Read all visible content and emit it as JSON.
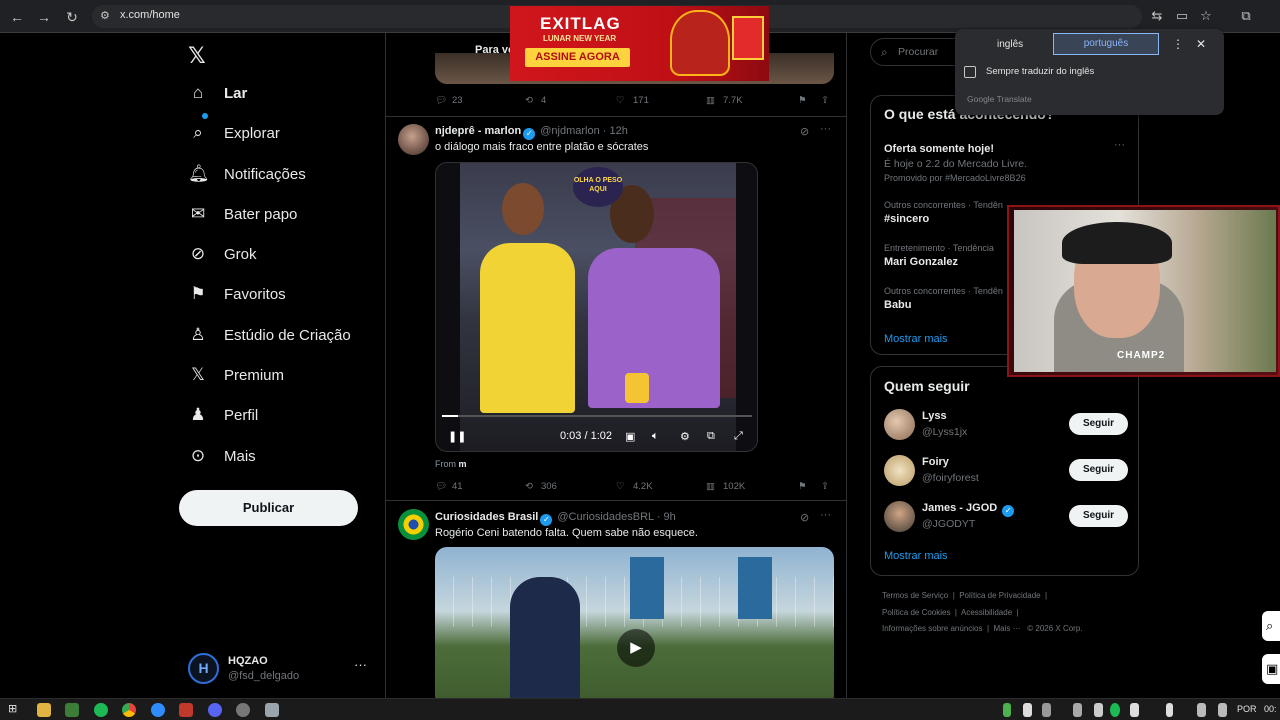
{
  "browser": {
    "url": "x.com/home"
  },
  "sidebar": {
    "items": [
      {
        "label": "Lar",
        "icon": "home-icon"
      },
      {
        "label": "Explorar",
        "icon": "search-icon"
      },
      {
        "label": "Notificações",
        "icon": "bell-icon"
      },
      {
        "label": "Bater papo",
        "icon": "mail-icon"
      },
      {
        "label": "Grok",
        "icon": "grok-icon"
      },
      {
        "label": "Favoritos",
        "icon": "bookmark-icon"
      },
      {
        "label": "Estúdio de Criação",
        "icon": "studio-icon"
      },
      {
        "label": "Premium",
        "icon": "x-icon"
      },
      {
        "label": "Perfil",
        "icon": "user-icon"
      },
      {
        "label": "Mais",
        "icon": "more-icon"
      }
    ],
    "post_label": "Publicar",
    "account": {
      "name": "HQZAO",
      "handle": "@fsd_delgado",
      "avatar_letter": "H"
    }
  },
  "feed": {
    "tab_label": "Para vo",
    "prev_actions": {
      "replies": "23",
      "reposts": "4",
      "likes": "171",
      "views": "7.7K"
    },
    "tweet1": {
      "name": "njdeprê - marlon",
      "handle": "@njdmarlon",
      "time": "· 12h",
      "text": "o diálogo mais fraco entre platão e sócrates",
      "video_time": "0:03 / 1:02",
      "video_progress": 0.05,
      "video_tag": "OLHA O PESO AQUI",
      "from_label": "From",
      "from_value": "m",
      "actions": {
        "replies": "41",
        "reposts": "306",
        "likes": "4.2K",
        "views": "102K"
      }
    },
    "tweet2": {
      "name": "Curiosidades Brasil",
      "handle": "@CuriosidadesBRL",
      "time": "· 9h",
      "text": "Rogério Ceni batendo falta. Quem sabe não esquece."
    }
  },
  "right": {
    "search_placeholder": "Procurar",
    "trends_title": "O que está acontecendo?",
    "promo": {
      "title": "Oferta somente hoje!",
      "desc": "É hoje o 2.2 do Mercado Livre.",
      "promoted": "Promovido por #MercadoLivre8B26"
    },
    "trends": [
      {
        "context": "Outros concorrentes · Tendên",
        "title": "#sincero"
      },
      {
        "context": "Entretenimento · Tendência",
        "title": "Mari Gonzalez"
      },
      {
        "context": "Outros concorrentes · Tendên",
        "title": "Babu"
      }
    ],
    "show_more": "Mostrar mais",
    "follow_title": "Quem seguir",
    "follow": [
      {
        "name": "Lyss",
        "handle": "@Lyss1jx",
        "button": "Seguir"
      },
      {
        "name": "Foiry",
        "handle": "@foiryforest",
        "button": "Seguir"
      },
      {
        "name": "James - JGOD",
        "handle": "@JGODYT",
        "button": "Seguir"
      }
    ],
    "follow_more": "Mostrar mais",
    "footer": [
      "Termos de Serviço",
      "Política de Privacidade",
      "Política de Cookies",
      "Acessibilidade",
      "Informações sobre anúncios",
      "Mais ···",
      "© 2026 X Corp."
    ]
  },
  "ad": {
    "brand": "EXITLAG",
    "sub": "LUNAR NEW YEAR",
    "cta": "ASSINE AGORA"
  },
  "translate": {
    "lang1": "inglês",
    "lang2": "português",
    "checkbox_label": "Sempre traduzir do inglês",
    "footer": "Google Translate"
  },
  "webcam": {
    "overlay": "CHAMP2"
  },
  "taskbar": {
    "lang": "POR",
    "time": "00:"
  }
}
